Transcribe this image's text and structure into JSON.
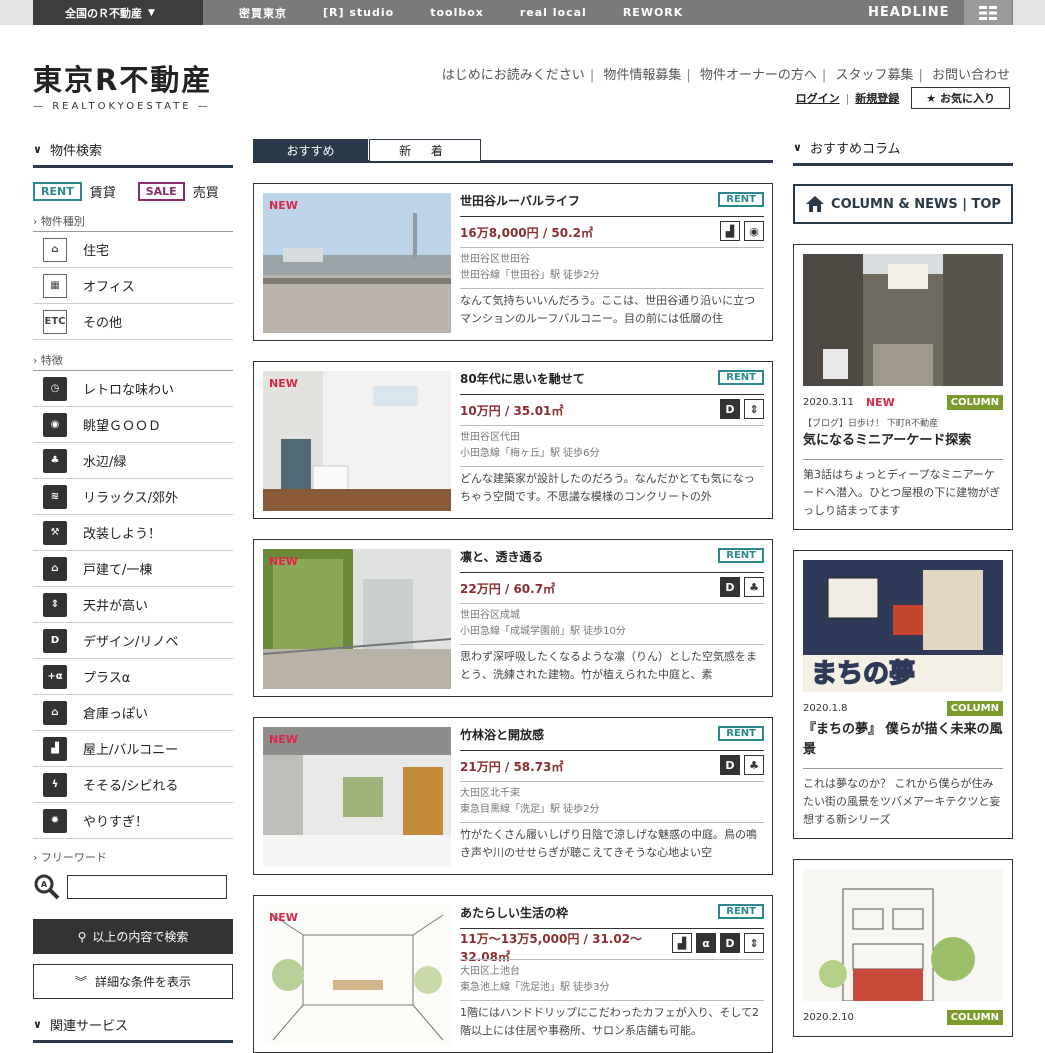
{
  "topbar": {
    "region": "全国のＲ不動産",
    "links": [
      "密買東京",
      "[R] studio",
      "toolbox",
      "real local",
      "REWORK"
    ],
    "headline": "HEADLINE"
  },
  "logo": {
    "main": "東京R不動産",
    "sub": "REALTOKYOESTATE"
  },
  "header": {
    "nav": [
      "はじめにお読みください",
      "物件情報募集",
      "物件オーナーの方へ",
      "スタッフ募集",
      "お問い合わせ"
    ],
    "login": "ログイン",
    "signup": "新規登録",
    "favorites": "★ お気に入り"
  },
  "sidebar": {
    "search_title": "物件検索",
    "rent_badge": "RENT",
    "rent_label": "賃貸",
    "sale_badge": "SALE",
    "sale_label": "売買",
    "type_title": "物件種別",
    "types": [
      {
        "label": "住宅",
        "icon": "house-icon",
        "glyph": "⌂"
      },
      {
        "label": "オフィス",
        "icon": "office-building-icon",
        "glyph": "▦"
      },
      {
        "label": "その他",
        "icon": "etc-icon",
        "glyph": "ETC"
      }
    ],
    "feature_title": "特徴",
    "features": [
      {
        "label": "レトロな味わい",
        "icon": "retro-clock-icon",
        "glyph": "◷"
      },
      {
        "label": "眺望ＧＯＯＤ",
        "icon": "eye-view-icon",
        "glyph": "◉"
      },
      {
        "label": "水辺/緑",
        "icon": "tree-water-icon",
        "glyph": "♣"
      },
      {
        "label": "リラックス/郊外",
        "icon": "relax-chair-icon",
        "glyph": "≋"
      },
      {
        "label": "改装しよう！",
        "icon": "drill-icon",
        "glyph": "⚒"
      },
      {
        "label": "戸建て/一棟",
        "icon": "detached-house-icon",
        "glyph": "⌂"
      },
      {
        "label": "天井が高い",
        "icon": "high-ceiling-icon",
        "glyph": "⇕"
      },
      {
        "label": "デザイン/リノベ",
        "icon": "design-d-icon",
        "glyph": "D"
      },
      {
        "label": "プラスα",
        "icon": "plus-alpha-icon",
        "glyph": "+α"
      },
      {
        "label": "倉庫っぽい",
        "icon": "warehouse-icon",
        "glyph": "⌂"
      },
      {
        "label": "屋上/バルコニー",
        "icon": "rooftop-icon",
        "glyph": "▟"
      },
      {
        "label": "そそる/シビれる",
        "icon": "lightning-icon",
        "glyph": "ϟ"
      },
      {
        "label": "やりすぎ！",
        "icon": "burst-icon",
        "glyph": "✹"
      }
    ],
    "freeword_title": "フリーワード",
    "search_button": "以上の内容で検索",
    "detail_button": "詳細な条件を表示",
    "related_title": "関連サービス"
  },
  "tabs": {
    "recommended": "おすすめ",
    "new": "新 着"
  },
  "listings": [
    {
      "new": "NEW",
      "title": "世田谷ルーバルライフ",
      "tag": "RENT",
      "price": "16万8,000円 / 50.2㎡",
      "area": "世田谷区世田谷",
      "station": "世田谷線「世田谷」駅 徒歩2分",
      "desc": "なんて気持ちいいんだろう。ここは、世田谷通り沿いに立つマンションのルーフバルコニー。目の前には低層の住",
      "icons": [
        "rooftop-icon",
        "eye-view-icon"
      ],
      "glyphs": [
        "▟",
        "◉"
      ]
    },
    {
      "new": "NEW",
      "title": "80年代に思いを馳せて",
      "tag": "RENT",
      "price": "10万円 / 35.01㎡",
      "area": "世田谷区代田",
      "station": "小田急線「梅ヶ丘」駅 徒歩6分",
      "desc": "どんな建築家が設計したのだろう。なんだかとても気になっちゃう空間です。不思議な模様のコンクリートの外",
      "icons": [
        "design-d-icon",
        "high-ceiling-icon"
      ],
      "glyphs": [
        "D",
        "⇕"
      ]
    },
    {
      "new": "NEW",
      "title": "凛と、透き通る",
      "tag": "RENT",
      "price": "22万円 / 60.7㎡",
      "area": "世田谷区成城",
      "station": "小田急線「成城学園前」駅 徒歩10分",
      "desc": "思わず深呼吸したくなるような凛（りん）とした空気感をまとう、洗練された建物。竹が植えられた中庭と、素",
      "icons": [
        "design-d-icon",
        "tree-water-icon"
      ],
      "glyphs": [
        "D",
        "♣"
      ]
    },
    {
      "new": "NEW",
      "title": "竹林浴と開放感",
      "tag": "RENT",
      "price": "21万円 / 58.73㎡",
      "area": "大田区北千束",
      "station": "東急目黒線「洗足」駅 徒歩2分",
      "desc": "竹がたくさん履いしげり日陰で涼しげな魅惑の中庭。鳥の鳴き声や川のせせらぎが聴こえてきそうな心地よい空",
      "icons": [
        "design-d-icon",
        "tree-water-icon"
      ],
      "glyphs": [
        "D",
        "♣"
      ]
    },
    {
      "new": "NEW",
      "title": "あたらしい生活の枠",
      "tag": "RENT",
      "price": "11万〜13万5,000円 / 31.02〜32.08㎡",
      "area": "大田区上池台",
      "station": "東急池上線「洗足池」駅 徒歩3分",
      "desc": "1階にはハンドドリップにこだわったカフェが入り、そして2階以上には住居や事務所、サロン系店舗も可能。",
      "icons": [
        "rooftop-icon",
        "plus-alpha-icon",
        "design-d-icon",
        "high-ceiling-icon"
      ],
      "glyphs": [
        "▟",
        "α",
        "D",
        "⇕"
      ]
    }
  ],
  "columns": {
    "title": "おすすめコラム",
    "top_button": "COLUMN & NEWS | TOP",
    "items": [
      {
        "date": "2020.3.11",
        "new": "NEW",
        "badge": "COLUMN",
        "kicker": "【ブログ】日歩け！ 下町R不動産",
        "title": "気になるミニアーケード探索",
        "desc": "第3話はちょっとディープなミニアーケードへ潜入。ひとつ屋根の下に建物がぎっしり詰まってます"
      },
      {
        "date": "2020.1.8",
        "new": "",
        "badge": "COLUMN",
        "kicker": "",
        "title": "『まちの夢』 僕らが描く未来の風景",
        "desc": "これは夢なのか？ これから僕らが住みたい街の風景をツバメアーキテクツと妄想する新シリーズ"
      },
      {
        "date": "2020.2.10",
        "new": "",
        "badge": "COLUMN",
        "kicker": "",
        "title": "",
        "desc": ""
      }
    ]
  },
  "colors": {
    "navy": "#2b3a4a",
    "rent": "#2a8a8f",
    "sale": "#8a2a6a",
    "new": "#d9284a",
    "column": "#7a9a2a",
    "price": "#8a2f2f"
  }
}
